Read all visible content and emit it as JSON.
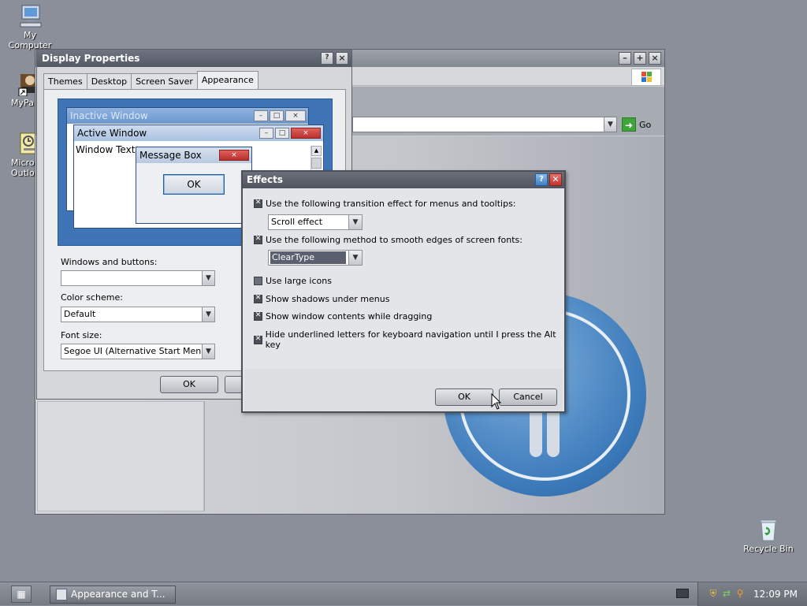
{
  "desktop": {
    "icons": [
      {
        "label": "My Computer",
        "icon": "my-computer-icon"
      },
      {
        "label": "MyPa",
        "icon": "my-documents-icon"
      },
      {
        "label": "Micro Outlo",
        "icon": "outlook-icon"
      },
      {
        "label": "Recycle Bin",
        "icon": "recycle-bin-icon"
      }
    ]
  },
  "background_window": {
    "go_label": "Go",
    "address_value": ""
  },
  "display_properties": {
    "title": "Display Properties",
    "tabs": [
      "Themes",
      "Desktop",
      "Screen Saver",
      "Appearance"
    ],
    "active_tab": "Appearance",
    "preview": {
      "inactive_title": "Inactive Window",
      "active_title": "Active Window",
      "window_text": "Window Text",
      "message_title": "Message Box",
      "ok_label": "OK"
    },
    "windows_buttons_label": "Windows and buttons:",
    "windows_buttons_value": "",
    "color_scheme_label": "Color scheme:",
    "color_scheme_value": "Default",
    "font_size_label": "Font size:",
    "font_size_value": "Segoe UI (Alternative Start Menu)",
    "ok_label": "OK",
    "cancel_label": ""
  },
  "effects_dialog": {
    "title": "Effects",
    "help_symbol": "?",
    "close_symbol": "✕",
    "transition_label": "Use the following transition effect for menus and tooltips:",
    "transition_checked": true,
    "transition_value": "Scroll effect",
    "smooth_label": "Use the following method to smooth edges of screen fonts:",
    "smooth_checked": true,
    "smooth_value": "ClearType",
    "large_icons_label": "Use large icons",
    "large_icons_checked": false,
    "shadows_label": "Show shadows under menus",
    "shadows_checked": true,
    "drag_label": "Show window contents while dragging",
    "drag_checked": true,
    "underline_label": "Hide underlined letters for keyboard navigation until I press the Alt key",
    "underline_checked": true,
    "ok_label": "OK",
    "cancel_label": "Cancel"
  },
  "taskbar": {
    "task_label": "Appearance and T...",
    "clock": "12:09 PM"
  },
  "colors": {
    "desktop": "#8a8f99",
    "titlebar": "#545a65",
    "accent_blue": "#3f74b7",
    "close_red": "#c0362f"
  }
}
